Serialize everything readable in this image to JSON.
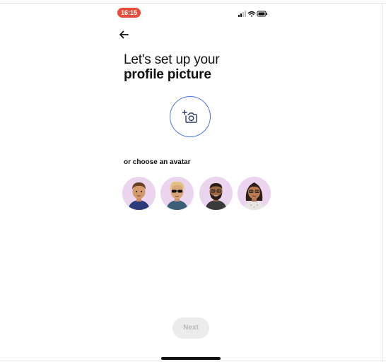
{
  "status_bar": {
    "time": "16:15",
    "time_pill_color": "#e74c3c",
    "icons": [
      "signal-icon",
      "wifi-icon",
      "battery-icon"
    ]
  },
  "navigation": {
    "back_icon": "back-arrow-icon"
  },
  "header": {
    "title_line1": "Let's set up your",
    "title_line2": "profile picture"
  },
  "photo_upload": {
    "icon": "add-photo-camera-icon",
    "accent_color": "#4a74e8"
  },
  "avatars": {
    "label": "or choose an avatar",
    "background_color": "#ead4ee",
    "items": [
      {
        "name": "avatar-man-brown-hair"
      },
      {
        "name": "avatar-man-sunglasses"
      },
      {
        "name": "avatar-man-beard"
      },
      {
        "name": "avatar-woman-glasses"
      }
    ]
  },
  "footer": {
    "next_label": "Next"
  }
}
